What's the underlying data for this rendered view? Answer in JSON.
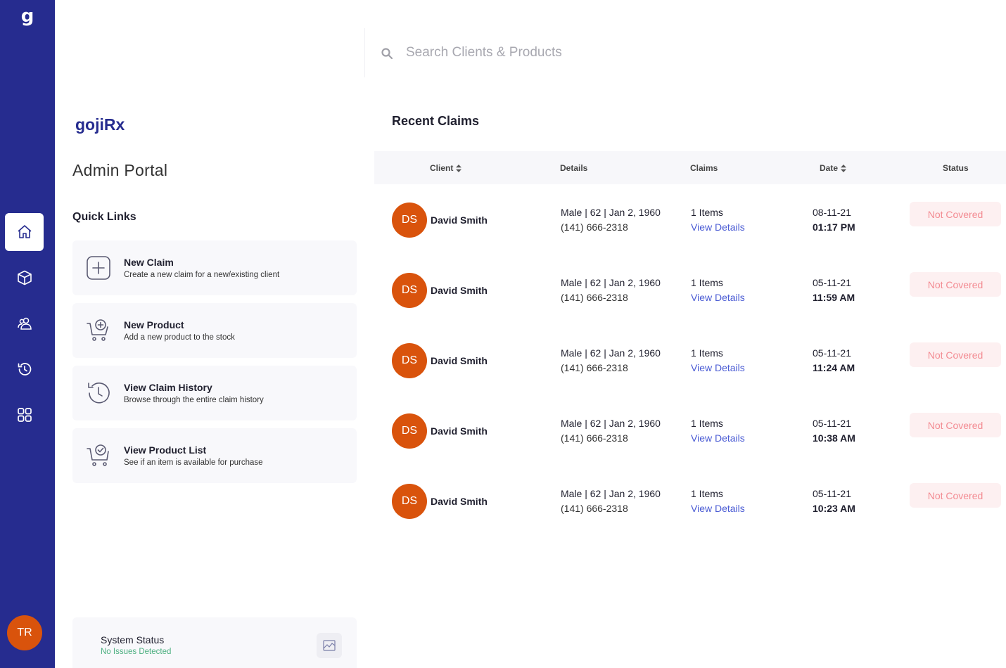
{
  "app": {
    "logo": "g",
    "brand": "gojiRx",
    "subtitle": "Admin Portal"
  },
  "sidebar": {
    "items": [
      {
        "name": "home",
        "icon": "home-icon",
        "active": true
      },
      {
        "name": "products",
        "icon": "box-icon",
        "active": false
      },
      {
        "name": "clients",
        "icon": "users-icon",
        "active": false
      },
      {
        "name": "history",
        "icon": "history-icon",
        "active": false
      },
      {
        "name": "apps",
        "icon": "grid-icon",
        "active": false
      }
    ],
    "user_initials": "TR"
  },
  "quick_links": {
    "title": "Quick Links",
    "items": [
      {
        "title": "New Claim",
        "desc": "Create a new claim for a new/existing client",
        "icon": "plus-square-icon"
      },
      {
        "title": "New Product",
        "desc": "Add a new product to the stock",
        "icon": "cart-plus-icon"
      },
      {
        "title": "View Claim History",
        "desc": "Browse through the entire claim history",
        "icon": "history-icon"
      },
      {
        "title": "View Product List",
        "desc": "See if an item is available for purchase",
        "icon": "cart-check-icon"
      }
    ]
  },
  "system_status": {
    "title": "System Status",
    "desc": "No Issues Detected",
    "icon": "chart-icon"
  },
  "search": {
    "placeholder": "Search Clients & Products",
    "icon": "search-icon"
  },
  "claims": {
    "title": "Recent Claims",
    "columns": [
      "Client",
      "Details",
      "Claims",
      "Date",
      "Status"
    ],
    "rows": [
      {
        "initials": "DS",
        "name": "David Smith",
        "detail1": "Male | 62 | Jan 2, 1960",
        "detail2": "(141) 666-2318",
        "items": "1 Items",
        "link": "View Details",
        "date": "08-11-21",
        "time": "01:17 PM",
        "status": "Not Covered"
      },
      {
        "initials": "DS",
        "name": "David Smith",
        "detail1": "Male | 62 | Jan 2, 1960",
        "detail2": "(141) 666-2318",
        "items": "1 Items",
        "link": "View Details",
        "date": "05-11-21",
        "time": "11:59 AM",
        "status": "Not Covered"
      },
      {
        "initials": "DS",
        "name": "David Smith",
        "detail1": "Male | 62 | Jan 2, 1960",
        "detail2": "(141) 666-2318",
        "items": "1 Items",
        "link": "View Details",
        "date": "05-11-21",
        "time": "11:24 AM",
        "status": "Not Covered"
      },
      {
        "initials": "DS",
        "name": "David Smith",
        "detail1": "Male | 62 | Jan 2, 1960",
        "detail2": "(141) 666-2318",
        "items": "1 Items",
        "link": "View Details",
        "date": "05-11-21",
        "time": "10:38 AM",
        "status": "Not Covered"
      },
      {
        "initials": "DS",
        "name": "David Smith",
        "detail1": "Male | 62 | Jan 2, 1960",
        "detail2": "(141) 666-2318",
        "items": "1 Items",
        "link": "View Details",
        "date": "05-11-21",
        "time": "10:23 AM",
        "status": "Not Covered"
      }
    ]
  },
  "colors": {
    "sidebar": "#262c8f",
    "avatar": "#d9530c",
    "link": "#4a5bd4",
    "status_text": "#f38b92",
    "status_bg": "#fdf0f1",
    "ok": "#4caf80"
  }
}
